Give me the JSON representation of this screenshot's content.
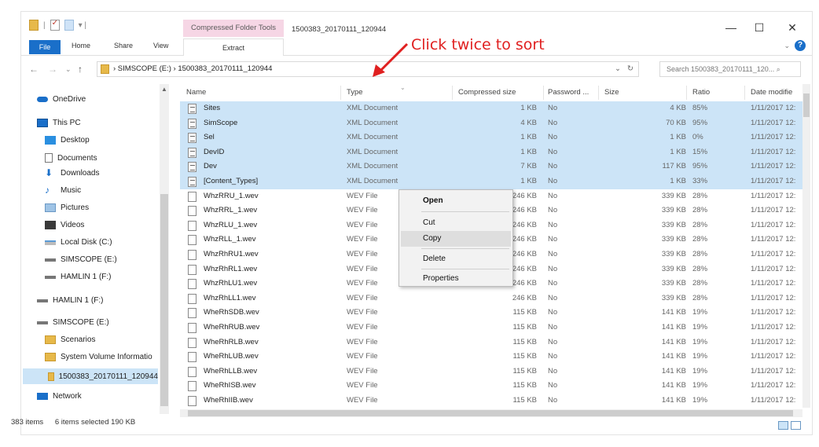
{
  "title_bar": {
    "context_tab": "Compressed Folder Tools",
    "window_title": "1500383_20170111_120944",
    "minimize": "—",
    "maximize": "☐",
    "close": "✕"
  },
  "ribbon": {
    "tabs": [
      "File",
      "Home",
      "Share",
      "View"
    ],
    "extract": "Extract",
    "collapse": "⌄",
    "help": "?"
  },
  "address": {
    "path": "›  SIMSCOPE (E:)  ›  1500383_20170111_120944",
    "dropdown": "⌄",
    "refresh": "↻",
    "search_placeholder": "Search 1500383_20170111_120... ⌕"
  },
  "nav_pane": {
    "items": [
      {
        "label": "OneDrive",
        "icon": "cloud-icon"
      },
      {
        "label": "This PC",
        "icon": "pc-icon"
      },
      {
        "label": "Desktop",
        "icon": "desktop-icon"
      },
      {
        "label": "Documents",
        "icon": "documents-icon"
      },
      {
        "label": "Downloads",
        "icon": "downloads-icon"
      },
      {
        "label": "Music",
        "icon": "music-icon"
      },
      {
        "label": "Pictures",
        "icon": "pictures-icon"
      },
      {
        "label": "Videos",
        "icon": "videos-icon"
      },
      {
        "label": "Local Disk (C:)",
        "icon": "disk-icon"
      },
      {
        "label": "SIMSCOPE (E:)",
        "icon": "drive-icon"
      },
      {
        "label": "HAMLIN 1 (F:)",
        "icon": "drive-icon"
      },
      {
        "label": "HAMLIN 1 (F:)",
        "icon": "drive-icon"
      },
      {
        "label": "SIMSCOPE (E:)",
        "icon": "drive-icon"
      },
      {
        "label": "Scenarios",
        "icon": "folder-icon"
      },
      {
        "label": "System Volume Informatio",
        "icon": "folder-icon"
      },
      {
        "label": "1500383_20170111_120944",
        "icon": "zip-folder-icon"
      },
      {
        "label": "Network",
        "icon": "network-icon"
      }
    ]
  },
  "columns": [
    "Name",
    "Type",
    "Compressed size",
    "Password ...",
    "Size",
    "Ratio",
    "Date modifie"
  ],
  "files": [
    {
      "name": "Sites",
      "type": "XML Document",
      "csize": "1 KB",
      "pw": "No",
      "size": "4 KB",
      "ratio": "85%",
      "date": "1/11/2017 12:",
      "sel": true,
      "kind": "xml"
    },
    {
      "name": "SimScope",
      "type": "XML Document",
      "csize": "4 KB",
      "pw": "No",
      "size": "70 KB",
      "ratio": "95%",
      "date": "1/11/2017 12:",
      "sel": true,
      "kind": "xml"
    },
    {
      "name": "Sel",
      "type": "XML Document",
      "csize": "1 KB",
      "pw": "No",
      "size": "1 KB",
      "ratio": "0%",
      "date": "1/11/2017 12:",
      "sel": true,
      "kind": "xml"
    },
    {
      "name": "DevID",
      "type": "XML Document",
      "csize": "1 KB",
      "pw": "No",
      "size": "1 KB",
      "ratio": "15%",
      "date": "1/11/2017 12:",
      "sel": true,
      "kind": "xml"
    },
    {
      "name": "Dev",
      "type": "XML Document",
      "csize": "7 KB",
      "pw": "No",
      "size": "117 KB",
      "ratio": "95%",
      "date": "1/11/2017 12:",
      "sel": true,
      "kind": "xml"
    },
    {
      "name": "[Content_Types]",
      "type": "XML Document",
      "csize": "1 KB",
      "pw": "No",
      "size": "1 KB",
      "ratio": "33%",
      "date": "1/11/2017 12:",
      "sel": true,
      "kind": "xml"
    },
    {
      "name": "WhzRRU_1.wev",
      "type": "WEV File",
      "csize": "246 KB",
      "pw": "No",
      "size": "339 KB",
      "ratio": "28%",
      "date": "1/11/2017 12:",
      "sel": false,
      "kind": "wev"
    },
    {
      "name": "WhzRRL_1.wev",
      "type": "WEV File",
      "csize": "246 KB",
      "pw": "No",
      "size": "339 KB",
      "ratio": "28%",
      "date": "1/11/2017 12:",
      "sel": false,
      "kind": "wev"
    },
    {
      "name": "WhzRLU_1.wev",
      "type": "WEV File",
      "csize": "246 KB",
      "pw": "No",
      "size": "339 KB",
      "ratio": "28%",
      "date": "1/11/2017 12:",
      "sel": false,
      "kind": "wev"
    },
    {
      "name": "WhzRLL_1.wev",
      "type": "WEV File",
      "csize": "246 KB",
      "pw": "No",
      "size": "339 KB",
      "ratio": "28%",
      "date": "1/11/2017 12:",
      "sel": false,
      "kind": "wev"
    },
    {
      "name": "WhzRhRU1.wev",
      "type": "WEV File",
      "csize": "246 KB",
      "pw": "No",
      "size": "339 KB",
      "ratio": "28%",
      "date": "1/11/2017 12:",
      "sel": false,
      "kind": "wev"
    },
    {
      "name": "WhzRhRL1.wev",
      "type": "WEV File",
      "csize": "246 KB",
      "pw": "No",
      "size": "339 KB",
      "ratio": "28%",
      "date": "1/11/2017 12:",
      "sel": false,
      "kind": "wev"
    },
    {
      "name": "WhzRhLU1.wev",
      "type": "WEV File",
      "csize": "246 KB",
      "pw": "No",
      "size": "339 KB",
      "ratio": "28%",
      "date": "1/11/2017 12:",
      "sel": false,
      "kind": "wev"
    },
    {
      "name": "WhzRhLL1.wev",
      "type": "WEV File",
      "csize": "246 KB",
      "pw": "No",
      "size": "339 KB",
      "ratio": "28%",
      "date": "1/11/2017 12:",
      "sel": false,
      "kind": "wev"
    },
    {
      "name": "WheRhSDB.wev",
      "type": "WEV File",
      "csize": "115 KB",
      "pw": "No",
      "size": "141 KB",
      "ratio": "19%",
      "date": "1/11/2017 12:",
      "sel": false,
      "kind": "wev"
    },
    {
      "name": "WheRhRUB.wev",
      "type": "WEV File",
      "csize": "115 KB",
      "pw": "No",
      "size": "141 KB",
      "ratio": "19%",
      "date": "1/11/2017 12:",
      "sel": false,
      "kind": "wev"
    },
    {
      "name": "WheRhRLB.wev",
      "type": "WEV File",
      "csize": "115 KB",
      "pw": "No",
      "size": "141 KB",
      "ratio": "19%",
      "date": "1/11/2017 12:",
      "sel": false,
      "kind": "wev"
    },
    {
      "name": "WheRhLUB.wev",
      "type": "WEV File",
      "csize": "115 KB",
      "pw": "No",
      "size": "141 KB",
      "ratio": "19%",
      "date": "1/11/2017 12:",
      "sel": false,
      "kind": "wev"
    },
    {
      "name": "WheRhLLB.wev",
      "type": "WEV File",
      "csize": "115 KB",
      "pw": "No",
      "size": "141 KB",
      "ratio": "19%",
      "date": "1/11/2017 12:",
      "sel": false,
      "kind": "wev"
    },
    {
      "name": "WheRhISB.wev",
      "type": "WEV File",
      "csize": "115 KB",
      "pw": "No",
      "size": "141 KB",
      "ratio": "19%",
      "date": "1/11/2017 12:",
      "sel": false,
      "kind": "wev"
    },
    {
      "name": "WheRhIIB.wev",
      "type": "WEV File",
      "csize": "115 KB",
      "pw": "No",
      "size": "141 KB",
      "ratio": "19%",
      "date": "1/11/2017 12:",
      "sel": false,
      "kind": "wev"
    }
  ],
  "context_menu": {
    "open": "Open",
    "cut": "Cut",
    "copy": "Copy",
    "delete": "Delete",
    "properties": "Properties"
  },
  "annotation": {
    "text": "Click twice to sort",
    "color": "#e02020"
  },
  "status": {
    "count": "383 items",
    "selected": "6 items selected  190 KB"
  },
  "colors": {
    "accent": "#1a6fc9",
    "selection": "#cce4f7",
    "context_tab": "#f6d6e5"
  }
}
